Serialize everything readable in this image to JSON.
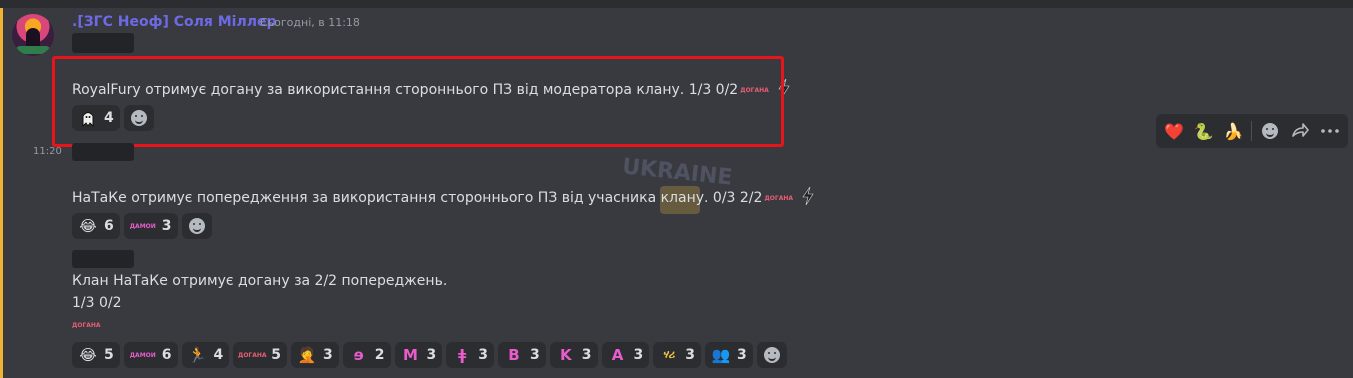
{
  "message": {
    "author": ".[ЗГС Неоф] Соля Міллер",
    "timestamp": "Сьогодні, в 11:18",
    "side_time": "11:20"
  },
  "posts": [
    {
      "text": "RoyalFury отримує догану за використання стороннього ПЗ від модератора клану. 1/3 0/2",
      "emoji_label": "ДОГАНА",
      "reactions": [
        {
          "icon": "ghost-emoji",
          "count": "4"
        }
      ]
    },
    {
      "text": "НаТаКе отримує попередження за використання стороннього ПЗ від учасника клану. 0/3 2/2",
      "emoji_label": "ДОГАНА",
      "reactions": [
        {
          "icon": "😂",
          "count": "6"
        },
        {
          "icon": "ДАМОИ",
          "count": "3"
        }
      ]
    },
    {
      "line1": "Клан НаТаКе отримує догану за 2/2 попереджень.",
      "line2": "1/3 0/2",
      "emoji_label": "ДОГАНА",
      "reactions": [
        {
          "icon": "😂",
          "count": "5"
        },
        {
          "icon": "ДАМОИ",
          "count": "6"
        },
        {
          "icon": "🏃",
          "count": "4"
        },
        {
          "icon": "ДОГАНА",
          "count": "5"
        },
        {
          "icon": "🤦",
          "count": "3"
        },
        {
          "icon": "ɘ",
          "count": "2"
        },
        {
          "icon": "M",
          "count": "3"
        },
        {
          "icon": "ǂ",
          "count": "3"
        },
        {
          "icon": "B",
          "count": "3"
        },
        {
          "icon": "K",
          "count": "3"
        },
        {
          "icon": "A",
          "count": "3"
        },
        {
          "icon": "ሃሪ",
          "count": "3"
        },
        {
          "icon": "👥",
          "count": "3"
        }
      ]
    }
  ],
  "toolbar": {
    "items": [
      "❤️",
      "🐍",
      "🍌"
    ]
  },
  "colors": {
    "author": "#6d6ae6",
    "highlight_border": "#e8141a",
    "mention_bar": "#f0b232"
  }
}
